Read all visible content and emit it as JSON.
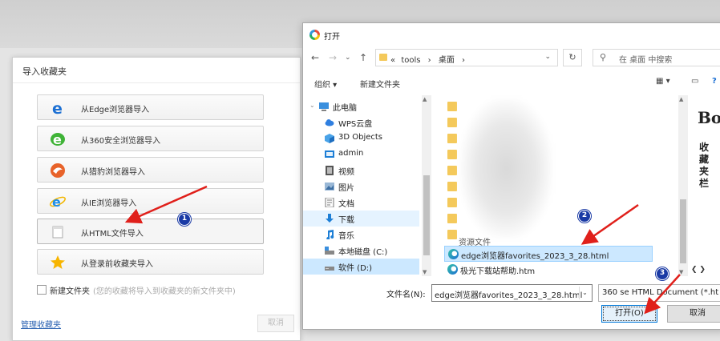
{
  "import_panel": {
    "title": "导入收藏夹",
    "options": [
      {
        "label": "从Edge浏览器导入",
        "icon": "edge-icon"
      },
      {
        "label": "从360安全浏览器导入",
        "icon": "360-browser-icon"
      },
      {
        "label": "从猎豹浏览器导入",
        "icon": "cheetah-browser-icon"
      },
      {
        "label": "从IE浏览器导入",
        "icon": "ie-icon"
      },
      {
        "label": "从HTML文件导入",
        "icon": "html-file-icon"
      },
      {
        "label": "从登录前收藏夹导入",
        "icon": "star-icon"
      }
    ],
    "new_folder_label": "新建文件夹",
    "new_folder_hint": "(您的收藏将导入到收藏夹的新文件夹中)",
    "manage_link": "管理收藏夹",
    "cancel_label": "取消"
  },
  "open_dialog": {
    "title": "打开",
    "path_prefix": "«",
    "path": [
      "tools",
      "桌面"
    ],
    "search_placeholder": "在 桌面 中搜索",
    "toolbar": {
      "organize": "组织 ▾",
      "new_folder": "新建文件夹"
    },
    "nav_items": [
      {
        "label": "此电脑",
        "icon": "computer-icon"
      },
      {
        "label": "WPS云盘",
        "icon": "cloud-icon"
      },
      {
        "label": "3D Objects",
        "icon": "cube-icon"
      },
      {
        "label": "admin",
        "icon": "user-folder-icon"
      },
      {
        "label": "视频",
        "icon": "video-icon"
      },
      {
        "label": "图片",
        "icon": "picture-icon"
      },
      {
        "label": "文档",
        "icon": "document-icon"
      },
      {
        "label": "下载",
        "icon": "download-icon"
      },
      {
        "label": "音乐",
        "icon": "music-icon"
      },
      {
        "label": "本地磁盘 (C:)",
        "icon": "disk-icon"
      },
      {
        "label": "软件 (D:)",
        "icon": "disk-icon"
      }
    ],
    "partial_folder": "资源文件",
    "files": [
      {
        "name": "edge浏览器favorites_2023_3_28.html",
        "selected": true
      },
      {
        "name": "极光下载站帮助.htm",
        "selected": false
      }
    ],
    "preview": {
      "title": "Bo",
      "vertical_text": "收藏夹栏"
    },
    "filename_label": "文件名(N):",
    "filename_value": "edge浏览器favorites_2023_3_28.html",
    "filetype_value": "360 se HTML Document (*.ht",
    "open_label": "打开(O)",
    "cancel_label": "取消"
  },
  "annotations": {
    "badges": [
      "1",
      "2",
      "3"
    ],
    "color": "#e0201b"
  }
}
